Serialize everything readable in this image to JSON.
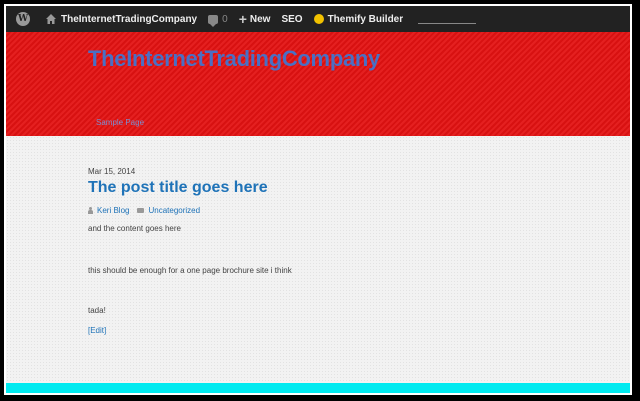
{
  "adminbar": {
    "site_name": "TheInternetTradingCompany",
    "comments_count": "0",
    "new_label": "New",
    "seo_label": "SEO",
    "themify_label": "Themify Builder"
  },
  "header": {
    "site_title": "TheInternetTradingCompany",
    "nav": [
      "Sample Page"
    ]
  },
  "post": {
    "date": "Mar 15, 2014",
    "title": "The post title goes here",
    "author": "Keri Blog",
    "category": "Uncategorized",
    "paragraphs": [
      "and the content goes here",
      "this should be enough for a one page brochure site i think",
      "tada!"
    ],
    "edit_label": "[Edit]"
  },
  "colors": {
    "header_bg": "#e31212",
    "title_blue": "#4a6fc4",
    "link_blue": "#1f73b8",
    "footer_bar": "#00eaf0",
    "adminbar_bg": "#222222"
  }
}
